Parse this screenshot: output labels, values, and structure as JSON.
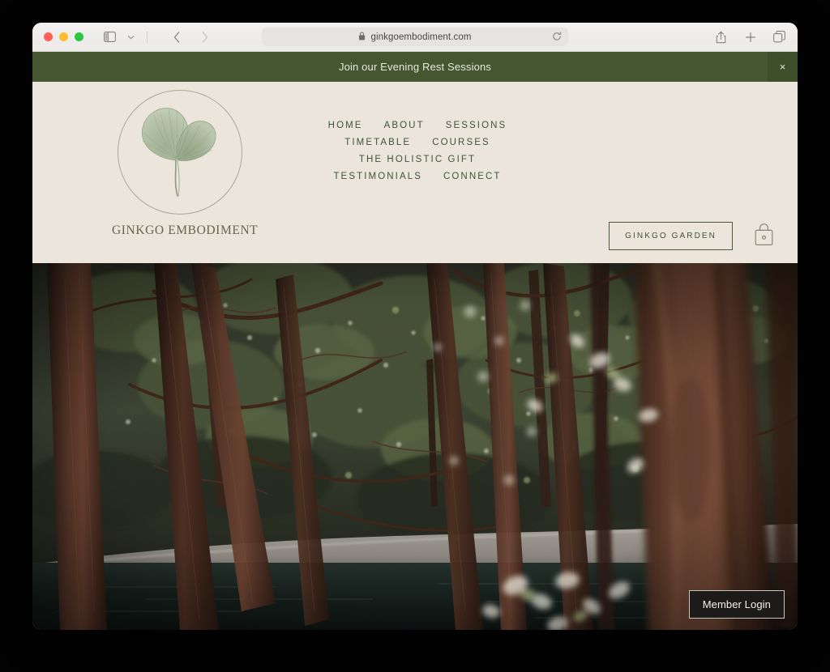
{
  "browser": {
    "url": "ginkgoembodiment.com",
    "lock_icon": "lock-icon",
    "reload_icon": "reload-icon",
    "sidebar_icon": "sidebar-toggle-icon",
    "chevron_icon": "chevron-down-icon",
    "back_icon": "back-chevron-icon",
    "forward_icon": "forward-chevron-icon",
    "share_icon": "share-icon",
    "newtab_icon": "plus-icon",
    "tabs_icon": "tab-overview-icon",
    "traffic_lights": [
      "close",
      "minimize",
      "zoom"
    ]
  },
  "announcement": {
    "text": "Join our Evening Rest Sessions",
    "close_label": "×",
    "background": "#445730"
  },
  "header": {
    "background": "#ece5dc",
    "brand_name": "GINKGO EMBODIMENT",
    "logo_icon": "ginkgo-leaf-logo",
    "nav_rows": [
      [
        "HOME",
        "ABOUT",
        "SESSIONS"
      ],
      [
        "TIMETABLE",
        "COURSES"
      ],
      [
        "THE HOLISTIC GIFT"
      ],
      [
        "TESTIMONIALS",
        "CONNECT"
      ]
    ],
    "cta_label": "GINKGO GARDEN",
    "cart_icon": "shopping-bag-icon",
    "nav_color": "#3f5434",
    "brand_color": "#6a6349"
  },
  "hero": {
    "image_alt": "forest-pond-scene",
    "member_login_label": "Member Login"
  }
}
